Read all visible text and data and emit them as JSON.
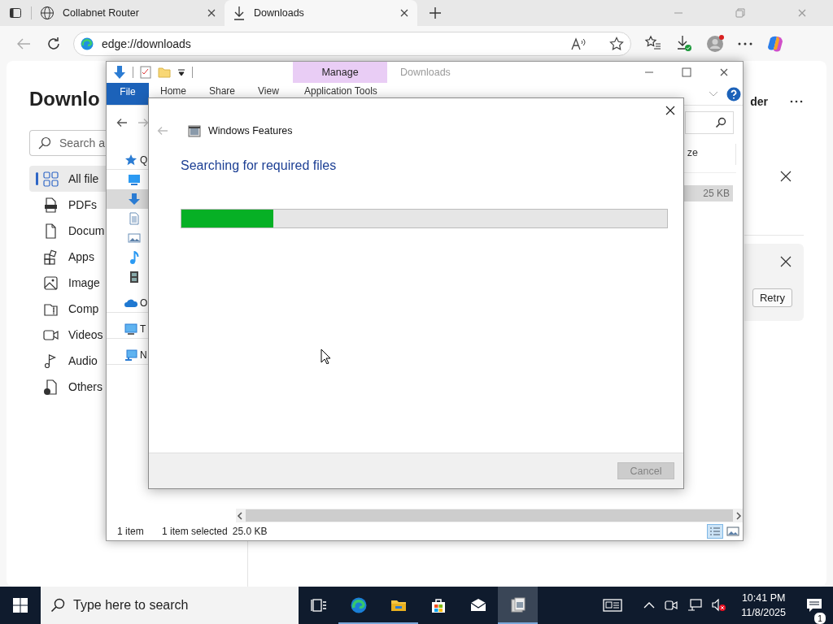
{
  "browser": {
    "tabs": [
      {
        "title": "Collabnet Router",
        "kind": "web",
        "selected": false
      },
      {
        "title": "Downloads",
        "kind": "downloads",
        "selected": true
      }
    ],
    "address": "edge://downloads"
  },
  "downloads_page": {
    "title": "Downlo",
    "search": {
      "placeholder": "Search a"
    },
    "categories": [
      {
        "label": "All file",
        "kind": "all",
        "selected": true
      },
      {
        "label": "PDFs",
        "kind": "pdf",
        "selected": false
      },
      {
        "label": "Docum",
        "kind": "document",
        "selected": false
      },
      {
        "label": "Apps",
        "kind": "app",
        "selected": false
      },
      {
        "label": "Image",
        "kind": "image",
        "selected": false
      },
      {
        "label": "Comp",
        "kind": "archive",
        "selected": false
      },
      {
        "label": "Videos",
        "kind": "video",
        "selected": false
      },
      {
        "label": "Audio",
        "kind": "audio",
        "selected": false
      },
      {
        "label": "Others",
        "kind": "other",
        "selected": false
      }
    ],
    "header_action": "der",
    "items": [
      {
        "kind": "done"
      },
      {
        "kind": "failed",
        "action": "Retry"
      }
    ]
  },
  "explorer": {
    "title": "Downloads",
    "context_tab": "Manage",
    "ribbon_tabs": [
      {
        "label": "File",
        "kind": "file"
      },
      {
        "label": "Home",
        "kind": "tab"
      },
      {
        "label": "Share",
        "kind": "tab"
      },
      {
        "label": "View",
        "kind": "tab"
      },
      {
        "label": "Application Tools",
        "kind": "context"
      }
    ],
    "nav": [
      {
        "label": "Q",
        "kind": "quick",
        "selected": false,
        "children": [
          {
            "kind": "desktop",
            "selected": false
          },
          {
            "kind": "downloads",
            "selected": true
          },
          {
            "kind": "documents",
            "selected": false
          },
          {
            "kind": "pictures",
            "selected": false
          },
          {
            "kind": "music",
            "selected": false
          },
          {
            "kind": "videos",
            "selected": false
          }
        ]
      },
      {
        "label": "O",
        "kind": "onedrive",
        "selected": false
      },
      {
        "label": "T",
        "kind": "pc",
        "selected": false
      },
      {
        "label": "N",
        "kind": "network",
        "selected": false
      }
    ],
    "column_header": "ze",
    "file_size": "25 KB",
    "status": {
      "item_count": "1 item",
      "selection": "1 item selected",
      "selection_size": "25.0 KB"
    }
  },
  "dialog": {
    "title": "Windows Features",
    "message": "Searching for required files",
    "progress": {
      "level": 0.19
    },
    "cancel": {
      "label": "Cancel",
      "disabled": true
    }
  },
  "taskbar": {
    "search": {
      "placeholder": "Type here to search"
    },
    "apps": [
      {
        "kind": "taskview",
        "open": false,
        "selected": false
      },
      {
        "kind": "edge",
        "open": true,
        "selected": false
      },
      {
        "kind": "explorer",
        "open": true,
        "selected": false
      },
      {
        "kind": "store",
        "open": false,
        "selected": false
      },
      {
        "kind": "mail",
        "open": false,
        "selected": false
      },
      {
        "kind": "features",
        "open": true,
        "selected": true
      }
    ],
    "time": "10:41 PM",
    "date": "11/8/2025",
    "notification_count": "1"
  }
}
